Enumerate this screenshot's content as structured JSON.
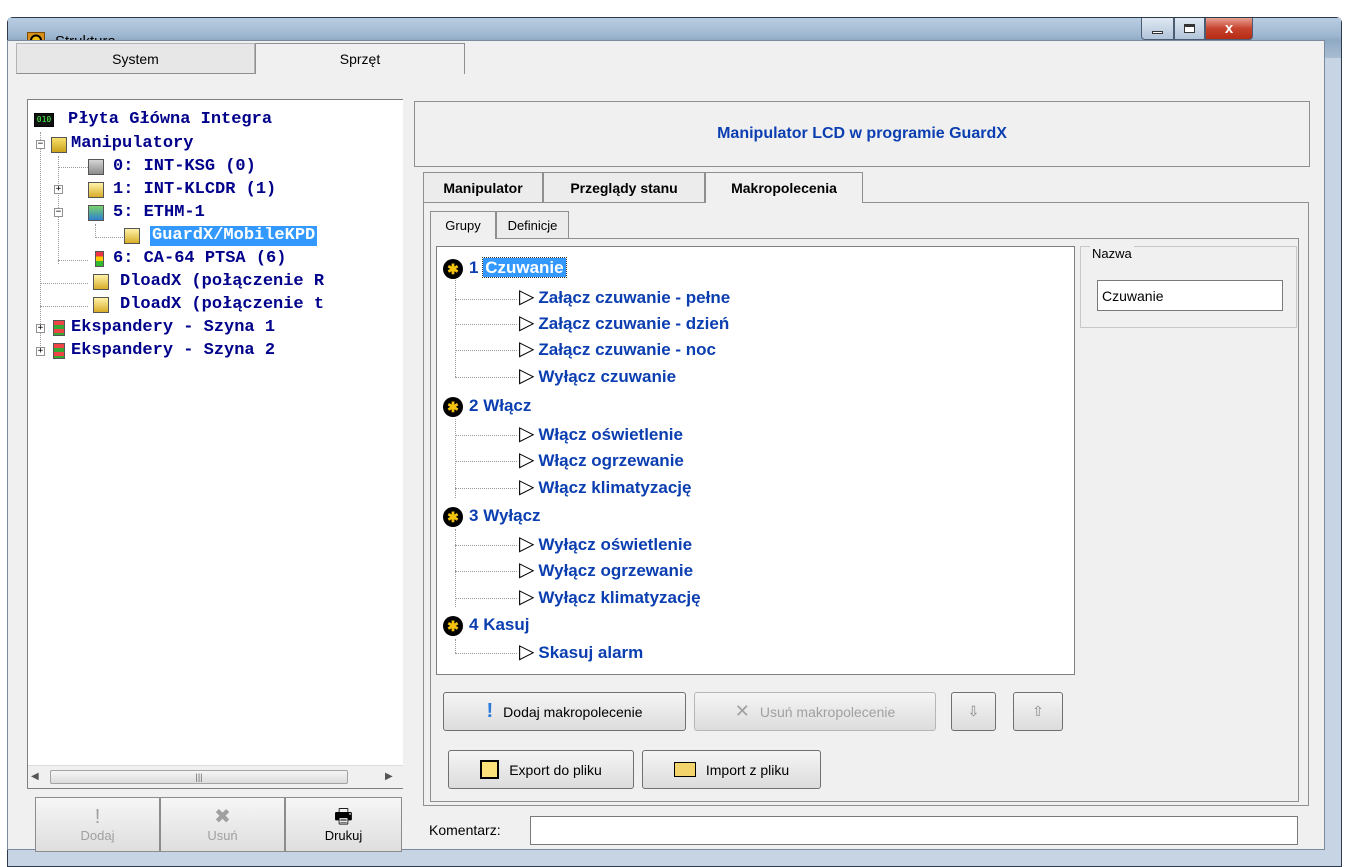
{
  "window": {
    "title": "Struktura",
    "close_glyph": "x"
  },
  "top_tabs": [
    "System",
    "Sprzęt"
  ],
  "tree": {
    "root": "Płyta Główna Integra",
    "nodes": [
      "Manipulatory",
      "0: INT-KSG      (0)",
      "1: INT-KLCDR    (1)",
      "5: ETHM-1",
      "GuardX/MobileKPD",
      "6: CA-64 PTSA   (6)",
      "DloadX (połączenie R",
      "DloadX (połączenie t",
      "Ekspandery - Szyna 1",
      "Ekspandery - Szyna 2"
    ],
    "selected": "GuardX/MobileKPD"
  },
  "left_buttons": [
    {
      "label": "Dodaj",
      "glyph": "!",
      "enabled": false
    },
    {
      "label": "Usuń",
      "glyph": "✖",
      "enabled": false
    },
    {
      "label": "Drukuj",
      "glyph": "🖶",
      "enabled": true
    }
  ],
  "header": {
    "title": "Manipulator LCD w programie GuardX"
  },
  "tabs": [
    "Manipulator",
    "Przeglądy stanu",
    "Makropolecenia"
  ],
  "subtabs": [
    "Grupy",
    "Definicje"
  ],
  "groups": [
    {
      "num": "1",
      "name": "Czuwanie",
      "items": [
        "Załącz czuwanie - pełne",
        "Załącz czuwanie - dzień",
        "Załącz czuwanie - noc",
        "Wyłącz czuwanie"
      ]
    },
    {
      "num": "2",
      "name": "Włącz",
      "items": [
        "Włącz oświetlenie",
        "Włącz ogrzewanie",
        "Włącz klimatyzację"
      ]
    },
    {
      "num": "3",
      "name": "Wyłącz",
      "items": [
        "Wyłącz oświetlenie",
        "Wyłącz ogrzewanie",
        "Wyłącz klimatyzację"
      ]
    },
    {
      "num": "4",
      "name": "Kasuj",
      "items": [
        "Skasuj alarm"
      ]
    }
  ],
  "buttons": {
    "add": "Dodaj makropolecenie",
    "remove": "Usuń makropolecenie",
    "export": "Export do pliku",
    "import": "Import z pliku"
  },
  "name_panel": {
    "legend": "Nazwa",
    "value": "Czuwanie"
  },
  "comment": {
    "label": "Komentarz:",
    "value": ""
  },
  "colors": {
    "accent": "#0b3eb0",
    "selection": "#3399ff"
  }
}
